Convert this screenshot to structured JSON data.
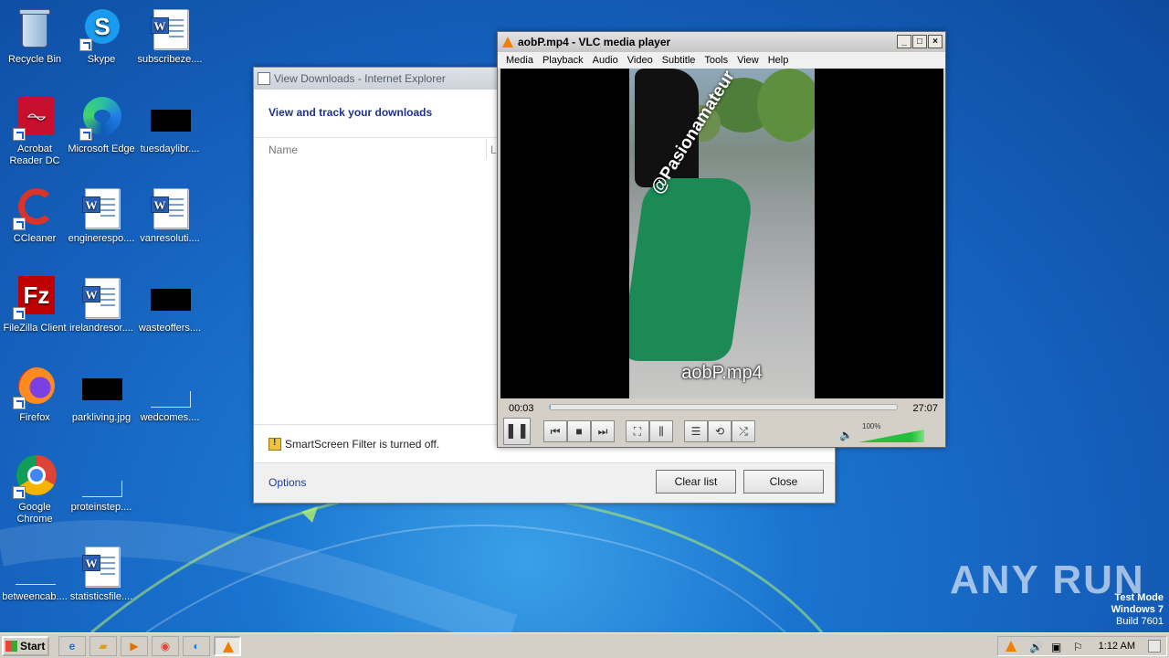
{
  "desktop": {
    "icons": [
      {
        "label": "Recycle Bin",
        "icon": "recycle-bin-icon"
      },
      {
        "label": "Skype",
        "icon": "skype-icon"
      },
      {
        "label": "subscribeze....",
        "icon": "word-doc-icon"
      },
      {
        "label": "Acrobat Reader DC",
        "icon": "acrobat-icon"
      },
      {
        "label": "Microsoft Edge",
        "icon": "edge-icon"
      },
      {
        "label": "tuesdaylibr....",
        "icon": "file-icon"
      },
      {
        "label": "CCleaner",
        "icon": "ccleaner-icon"
      },
      {
        "label": "enginerespo....",
        "icon": "word-doc-icon"
      },
      {
        "label": "vanresoluti....",
        "icon": "word-doc-icon"
      },
      {
        "label": "FileZilla Client",
        "icon": "filezilla-icon"
      },
      {
        "label": "irelandresor....",
        "icon": "word-doc-icon"
      },
      {
        "label": "wasteoffers....",
        "icon": "file-icon"
      },
      {
        "label": "Firefox",
        "icon": "firefox-icon"
      },
      {
        "label": "parkliving.jpg",
        "icon": "image-icon"
      },
      {
        "label": "wedcomes....",
        "icon": "file-icon"
      },
      {
        "label": "Google Chrome",
        "icon": "chrome-icon"
      },
      {
        "label": "proteinstep....",
        "icon": "file-icon"
      },
      {
        "label": "betweencab....",
        "icon": "file-icon"
      },
      {
        "label": "statisticsfile....",
        "icon": "word-doc-icon"
      }
    ]
  },
  "ie": {
    "title": "View Downloads - Internet Explorer",
    "heading": "View and track your downloads",
    "col_name": "Name",
    "col_l": "L",
    "smartscreen": "SmartScreen Filter is turned off.",
    "options": "Options",
    "clear_list": "Clear list",
    "close": "Close"
  },
  "vlc": {
    "title": "aobP.mp4 - VLC media player",
    "menu": [
      "Media",
      "Playback",
      "Audio",
      "Video",
      "Subtitle",
      "Tools",
      "View",
      "Help"
    ],
    "video_watermark": "@Pasionamateur",
    "overlay_name": "aobP.mp4",
    "elapsed": "00:03",
    "duration": "27:07",
    "volume_label": "100%",
    "volume_fraction": 1.0,
    "progress_fraction": 0.002,
    "win_min": "_",
    "win_max": "□",
    "win_close": "×",
    "accent": "#f08000"
  },
  "watermark": {
    "brand": "ANY RUN",
    "test_mode": "Test Mode",
    "os": "Windows 7",
    "build": "Build 7601"
  },
  "taskbar": {
    "start": "Start",
    "clock": "1:12 AM"
  }
}
